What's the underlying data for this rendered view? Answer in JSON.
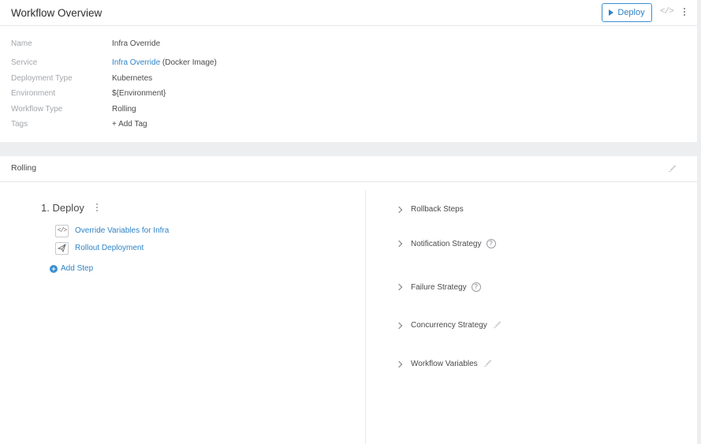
{
  "header": {
    "title": "Workflow Overview",
    "deploy_label": "Deploy",
    "code_icon": "code-icon",
    "more_icon": "kebab-menu-icon"
  },
  "details": {
    "name_label": "Name",
    "name_value": "Infra Override",
    "service_label": "Service",
    "service_link": "Infra Override",
    "service_suffix": " (Docker Image)",
    "deployment_type_label": "Deployment Type",
    "deployment_type_value": "Kubernetes",
    "environment_label": "Environment",
    "environment_value": "${Environment}",
    "workflow_type_label": "Workflow Type",
    "workflow_type_value": "Rolling",
    "tags_label": "Tags",
    "add_tag": "+ Add Tag"
  },
  "section": {
    "title": "Rolling"
  },
  "phase": {
    "title": "1. Deploy",
    "steps": [
      {
        "label": "Override Variables for Infra",
        "icon": "code-icon"
      },
      {
        "label": "Rollout Deployment",
        "icon": "paper-plane-icon"
      }
    ],
    "add_step": "Add Step"
  },
  "strategies": [
    {
      "label": "Rollback Steps"
    },
    {
      "label": "Notification Strategy",
      "help": "?"
    },
    {
      "label": "Failure Strategy",
      "help": "?"
    },
    {
      "label": "Concurrency Strategy"
    },
    {
      "label": "Workflow Variables"
    }
  ],
  "colors": {
    "accent": "#2f83c6",
    "band": "#eceef0",
    "muted_text": "#a3a6ab"
  }
}
